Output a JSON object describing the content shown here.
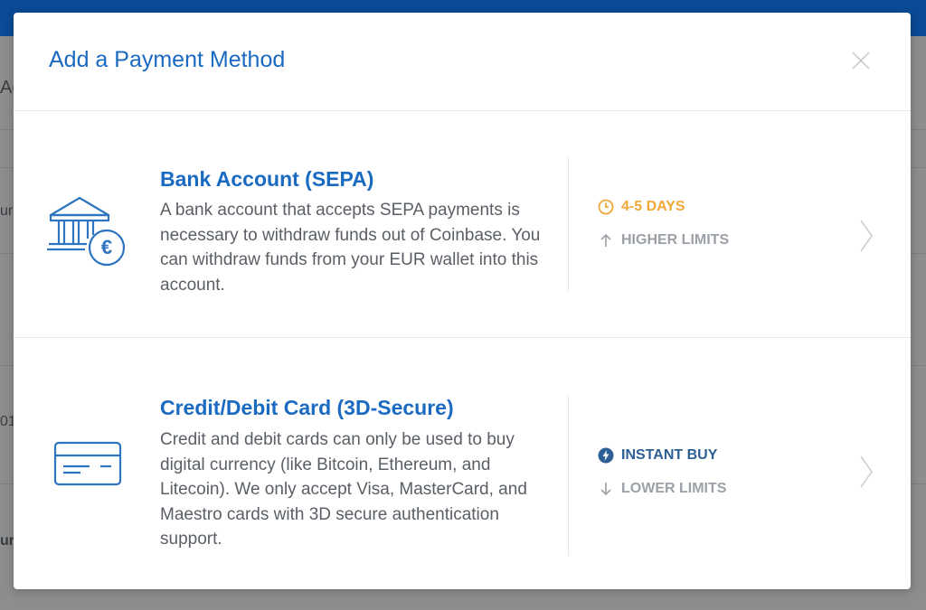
{
  "modal": {
    "title": "Add a Payment Method"
  },
  "background": {
    "fragments": [
      "Ac",
      "ur",
      "01",
      "ur"
    ]
  },
  "options": [
    {
      "title": "Bank Account (SEPA)",
      "description": "A bank account that accepts SEPA payments is necessary to withdraw funds out of Coinbase. You can withdraw funds from your EUR wallet into this account.",
      "features": [
        {
          "icon": "clock-icon",
          "label": "4-5 DAYS"
        },
        {
          "icon": "arrow-up-icon",
          "label": "HIGHER LIMITS"
        }
      ]
    },
    {
      "title": "Credit/Debit Card (3D-Secure)",
      "description": "Credit and debit cards can only be used to buy digital currency (like Bitcoin, Ethereum, and Litecoin). We only accept Visa, MasterCard, and Maestro cards with 3D secure authentication support.",
      "features": [
        {
          "icon": "lightning-icon",
          "label": "INSTANT BUY"
        },
        {
          "icon": "arrow-down-icon",
          "label": "LOWER LIMITS"
        }
      ]
    }
  ],
  "colors": {
    "accent": "#1b6ac2",
    "orange": "#f0a83a",
    "muted": "#9ba1a7"
  }
}
